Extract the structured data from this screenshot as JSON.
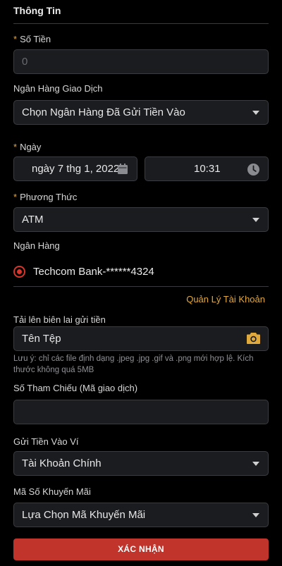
{
  "header": {
    "title": "Thông Tin"
  },
  "amount": {
    "label": "Số Tiền",
    "placeholder": "0"
  },
  "transaction_bank": {
    "label": "Ngân Hàng Giao Dịch",
    "value": "Chọn Ngân Hàng Đã Gửi Tiền Vào"
  },
  "date": {
    "label": "Ngày",
    "date_value": "ngày 7 thg 1, 2022",
    "time_value": "10:31"
  },
  "method": {
    "label": "Phương Thức",
    "value": "ATM"
  },
  "bank": {
    "label": "Ngân Hàng",
    "account": "Techcom Bank-******4324",
    "manage_link": "Quản Lý Tài Khoản"
  },
  "upload": {
    "label": "Tải lên biên lai gửi tiền",
    "file_name": "Tên Tệp",
    "note": "Lưu ý: chỉ các file định dạng .jpeg .jpg .gif và .png mới hợp lệ. Kích thước không quá 5MB"
  },
  "reference": {
    "label": "Số Tham Chiếu (Mã giao dịch)",
    "value": ""
  },
  "wallet": {
    "label": "Gửi Tiền Vào Ví",
    "value": "Tài Khoản Chính"
  },
  "promo": {
    "label": "Mã Số Khuyến Mãi",
    "value": "Lựa Chọn Mã Khuyến Mãi"
  },
  "submit": {
    "label": "XÁC NHẬN"
  },
  "colors": {
    "accent": "#e0a93c",
    "primary_button": "#c0342b",
    "radio": "#d8352c",
    "field_bg": "#1b1c20"
  }
}
